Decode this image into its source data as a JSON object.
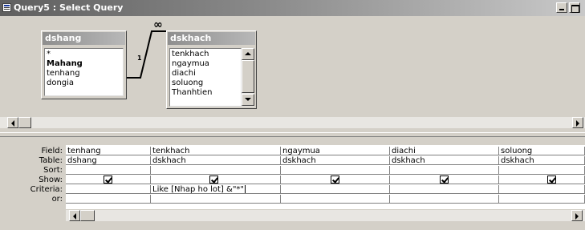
{
  "window": {
    "title": "Query5 : Select Query"
  },
  "tables": [
    {
      "name": "dshang",
      "fields": [
        "*",
        "Mahang",
        "tenhang",
        "dongia"
      ],
      "bold_field": "Mahang"
    },
    {
      "name": "dskhach",
      "fields": [
        "tenkhach",
        "ngaymua",
        "diachi",
        "soluong",
        "Thanhtien"
      ]
    }
  ],
  "relationship": {
    "one_label": "1",
    "many_label": "∞"
  },
  "grid": {
    "row_labels": [
      "Field:",
      "Table:",
      "Sort:",
      "Show:",
      "Criteria:",
      "or:"
    ],
    "columns": [
      {
        "field": "tenhang",
        "table": "dshang",
        "sort": "",
        "show": true,
        "criteria": "",
        "or": ""
      },
      {
        "field": "tenkhach",
        "table": "dskhach",
        "sort": "",
        "show": true,
        "criteria": "Like [Nhap ho lot] &\"*\"",
        "or": ""
      },
      {
        "field": "ngaymua",
        "table": "dskhach",
        "sort": "",
        "show": true,
        "criteria": "",
        "or": ""
      },
      {
        "field": "diachi",
        "table": "dskhach",
        "sort": "",
        "show": true,
        "criteria": "",
        "or": ""
      },
      {
        "field": "soluong",
        "table": "dskhach",
        "sort": "",
        "show": true,
        "criteria": "",
        "or": ""
      }
    ]
  },
  "colors": {
    "titlebar_start": "#5f5f5f",
    "dialog_bg": "#d4d0c8",
    "grid_bg": "#ffffff"
  }
}
